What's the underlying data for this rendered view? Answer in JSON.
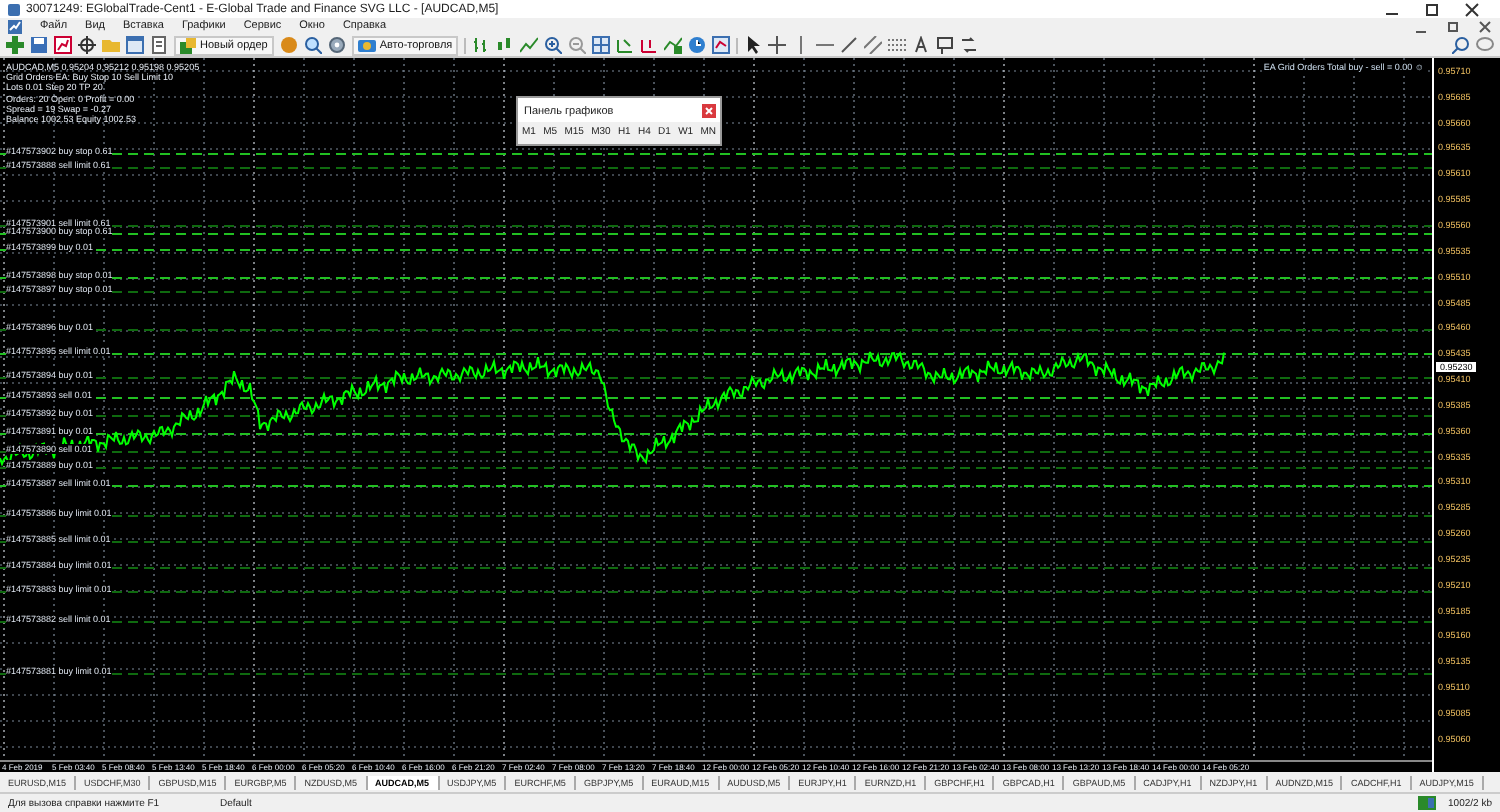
{
  "window": {
    "title": "30071249: EGlobalTrade-Cent1 - E-Global Trade and Finance SVG LLC - [AUDCAD,M5]"
  },
  "menu": [
    "Файл",
    "Вид",
    "Вставка",
    "Графики",
    "Сервис",
    "Окно",
    "Справка"
  ],
  "toolbar": {
    "new_order": "Новый ордер",
    "auto_trading": "Авто-торговля"
  },
  "chart": {
    "info_lines": [
      "AUDCAD,M5  0.95204 0.95212 0.95198 0.95205",
      "Grid Orders EA: Buy Stop 10  Sell Limit 10",
      "Lots 0.01  Step 20  TP 20",
      "Orders: 20  Open: 0  Profit = 0.00",
      "Spread = 19  Swap = -0.27",
      "Balance 1002.53  Equity 1002.53"
    ],
    "ea_label": "EA Grid Orders  Total buy - sell = 0.00 ☺",
    "orders": [
      {
        "label": "#147573902 buy stop 0.61",
        "kind": "buy"
      },
      {
        "label": "#147573888 sell limit 0.61",
        "kind": "sell"
      },
      {
        "label": "#147573901 sell limit 0.61",
        "kind": "sell"
      },
      {
        "label": "#147573900 buy stop 0.61",
        "kind": "buy"
      },
      {
        "label": "#147573899 buy  0.01",
        "kind": "buy"
      },
      {
        "label": "#147573898 buy stop 0.01",
        "kind": "buy"
      },
      {
        "label": "#147573897 buy stop 0.01",
        "kind": "sell"
      },
      {
        "label": "#147573896 buy  0.01",
        "kind": "sell"
      },
      {
        "label": "#147573895 sell limit 0.01",
        "kind": "buy"
      },
      {
        "label": "#147573894 buy  0.01",
        "kind": "sell"
      },
      {
        "label": "#147573893 sell  0.01",
        "kind": "buy"
      },
      {
        "label": "#147573892 buy  0.01",
        "kind": "sell"
      },
      {
        "label": "#147573891 buy  0.01",
        "kind": "buy"
      },
      {
        "label": "#147573890 sell  0.01",
        "kind": "sell"
      },
      {
        "label": "#147573889 buy  0.01",
        "kind": "sell"
      },
      {
        "label": "#147573887 sell limit 0.01",
        "kind": "buy"
      },
      {
        "label": "#147573886 buy limit 0.01",
        "kind": "sell"
      },
      {
        "label": "#147573885 sell limit 0.01",
        "kind": "sell"
      },
      {
        "label": "#147573884 buy limit 0.01",
        "kind": "sell"
      },
      {
        "label": "#147573883 buy limit 0.01",
        "kind": "sell"
      },
      {
        "label": "#147573882 sell limit 0.01",
        "kind": "sell"
      },
      {
        "label": "#147573881 buy limit 0.01",
        "kind": "sell"
      }
    ],
    "price_ticks": [
      "0.95710",
      "0.95685",
      "0.95660",
      "0.95635",
      "0.95610",
      "0.95585",
      "0.95560",
      "0.95535",
      "0.95510",
      "0.95485",
      "0.95460",
      "0.95435",
      "0.95410",
      "0.95385",
      "0.95360",
      "0.95335",
      "0.95310",
      "0.95285",
      "0.95260",
      "0.95235",
      "0.95210",
      "0.95185",
      "0.95160",
      "0.95135",
      "0.95110",
      "0.95085",
      "0.95060"
    ],
    "current_price": "0.95230",
    "time_ticks": [
      "4 Feb 2019",
      "5 Feb 03:40",
      "5 Feb 08:40",
      "5 Feb 13:40",
      "5 Feb 18:40",
      "6 Feb 00:00",
      "6 Feb 05:20",
      "6 Feb 10:40",
      "6 Feb 16:00",
      "6 Feb 21:20",
      "7 Feb 02:40",
      "7 Feb 08:00",
      "7 Feb 13:20",
      "7 Feb 18:40",
      "12 Feb 00:00",
      "12 Feb 05:20",
      "12 Feb 10:40",
      "12 Feb 16:00",
      "12 Feb 21:20",
      "13 Feb 02:40",
      "13 Feb 08:00",
      "13 Feb 13:20",
      "13 Feb 18:40",
      "14 Feb 00:00",
      "14 Feb 05:20"
    ]
  },
  "periods_panel": {
    "title": "Панель графиков",
    "buttons": [
      "M1",
      "M5",
      "M15",
      "M30",
      "H1",
      "H4",
      "D1",
      "W1",
      "MN"
    ]
  },
  "tabs": [
    {
      "label": "EURUSD,M15",
      "selected": false
    },
    {
      "label": "USDCHF,M30",
      "selected": false
    },
    {
      "label": "GBPUSD,M15",
      "selected": false
    },
    {
      "label": "EURGBP,M5",
      "selected": false
    },
    {
      "label": "NZDUSD,M5",
      "selected": false
    },
    {
      "label": "AUDCAD,M5",
      "selected": true
    },
    {
      "label": "USDJPY,M5",
      "selected": false
    },
    {
      "label": "EURCHF,M5",
      "selected": false
    },
    {
      "label": "GBPJPY,M5",
      "selected": false
    },
    {
      "label": "EURAUD,M15",
      "selected": false
    },
    {
      "label": "AUDUSD,M5",
      "selected": false
    },
    {
      "label": "EURJPY,H1",
      "selected": false
    },
    {
      "label": "EURNZD,H1",
      "selected": false
    },
    {
      "label": "GBPCHF,H1",
      "selected": false
    },
    {
      "label": "GBPCAD,H1",
      "selected": false
    },
    {
      "label": "GBPAUD,M5",
      "selected": false
    },
    {
      "label": "CADJPY,H1",
      "selected": false
    },
    {
      "label": "NZDJPY,H1",
      "selected": false
    },
    {
      "label": "AUDNZD,M15",
      "selected": false
    },
    {
      "label": "CADCHF,H1",
      "selected": false
    },
    {
      "label": "AUDJPY,M15",
      "selected": false
    }
  ],
  "status_bar": {
    "help": "Для вызова справки нажмите F1",
    "profile": "Default",
    "traffic": "1002/2 kb"
  }
}
